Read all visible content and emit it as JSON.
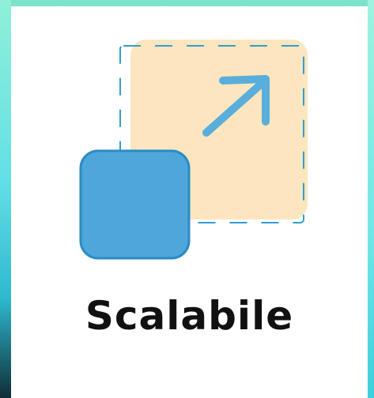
{
  "label": "Scalabile",
  "icon": {
    "name": "scalable-icon",
    "colors": {
      "small_square_fill": "#4ea6d9",
      "small_square_stroke": "#2a8cc4",
      "large_square_fill": "#fde6bf",
      "dashed_outline": "#2f9fd0",
      "arrow": "#5aaedb"
    }
  },
  "background_colors": {
    "card": "#ffffff",
    "frame_top": "#7de3c8",
    "frame_bottom": "#1a5a66"
  }
}
